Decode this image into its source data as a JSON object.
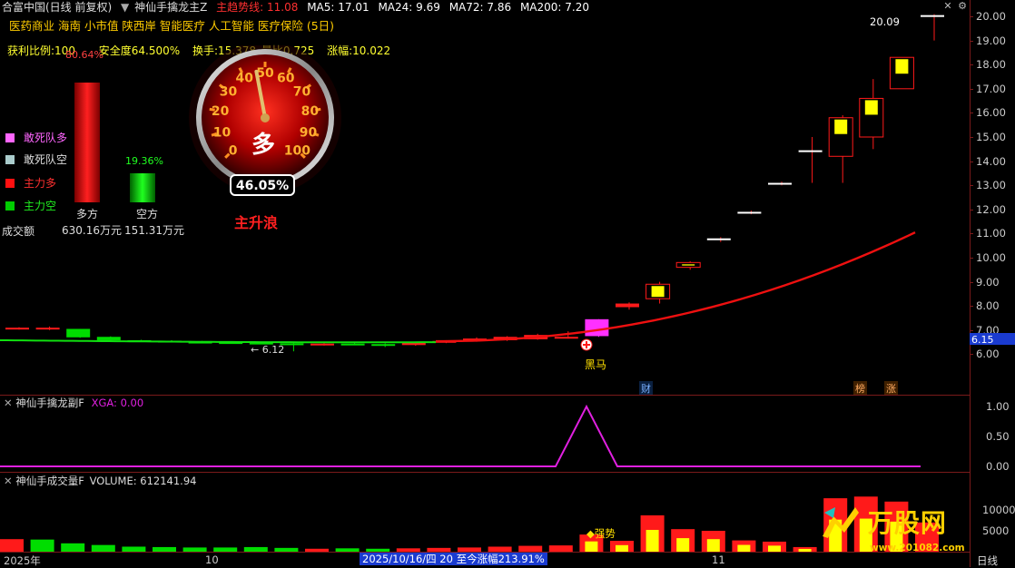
{
  "header": {
    "stock_title": "合富中国(日线 前复权)",
    "indicator_name": "神仙手擒龙主Z",
    "trend_label": "主趋势线: 11.08",
    "ma5": "MA5: 17.01",
    "ma24": "MA24: 9.69",
    "ma72": "MA72: 7.86",
    "ma200": "MA200: 7.20",
    "sector_tags": "医药商业 海南 小市值 陕西岸 智能医疗 人工智能 医疗保险 (5日)"
  },
  "stats": {
    "profit_ratio": "获利比例:100",
    "safety": "安全度64.500%",
    "turnover": "换手:15.378",
    "volume_ratio": "量比0.725",
    "change": "涨幅:10.022"
  },
  "bull": {
    "percent_label": "80.64%",
    "fraction": 0.8064,
    "name": "多方",
    "amount": "630.16万元"
  },
  "bear": {
    "percent_label": "19.36%",
    "fraction": 0.1936,
    "name": "空方",
    "amount": "151.31万元"
  },
  "legend": [
    {
      "label": "敢死队多",
      "color": "#ff66ff"
    },
    {
      "label": "敢死队空",
      "color": "#aacccc"
    },
    {
      "label": "主力多",
      "color": "#ff1010"
    },
    {
      "label": "主力空",
      "color": "#00cc00"
    }
  ],
  "turnover_label": "成交额",
  "gauge": {
    "ticks": [
      "0",
      "10",
      "20",
      "30",
      "40",
      "50",
      "60",
      "70",
      "80",
      "90",
      "100"
    ],
    "center_text": "多",
    "value_label": "46.05%",
    "value": 46.05,
    "phase": "主升浪"
  },
  "main_chart": {
    "price_ticks": [
      "20.00",
      "19.00",
      "18.00",
      "17.00",
      "16.00",
      "15.00",
      "14.00",
      "13.00",
      "12.00",
      "11.00",
      "10.00",
      "9.00",
      "8.00",
      "7.00",
      "6.00"
    ],
    "current_price": "6.15",
    "high_label": "20.09",
    "low_label": "← 6.12",
    "signal_label": "黑马",
    "marker_cai": "财",
    "marker_bang": "榜",
    "marker_zhang": "涨"
  },
  "sub1": {
    "title": "神仙手擒龙副F",
    "value": "XGA: 0.00",
    "ticks": [
      "1.00",
      "0.50",
      "0.00"
    ]
  },
  "sub2": {
    "title": "神仙手成交量F",
    "value": "VOLUME: 612141.94",
    "ticks": [
      "10000",
      "5000"
    ],
    "signal_label": "◆强势"
  },
  "footer": {
    "year": "2025年",
    "m10": "10",
    "m11": "11",
    "range_text": "2025/10/16/四 20 至今涨幅213.91%",
    "period": "日线",
    "watermark": "万股网",
    "watermark_url": "www.201082.com"
  },
  "colors": {
    "up": "#ff1a1a",
    "down": "#00dd00",
    "yellow": "#ffff00",
    "magenta": "#e020e0"
  }
}
